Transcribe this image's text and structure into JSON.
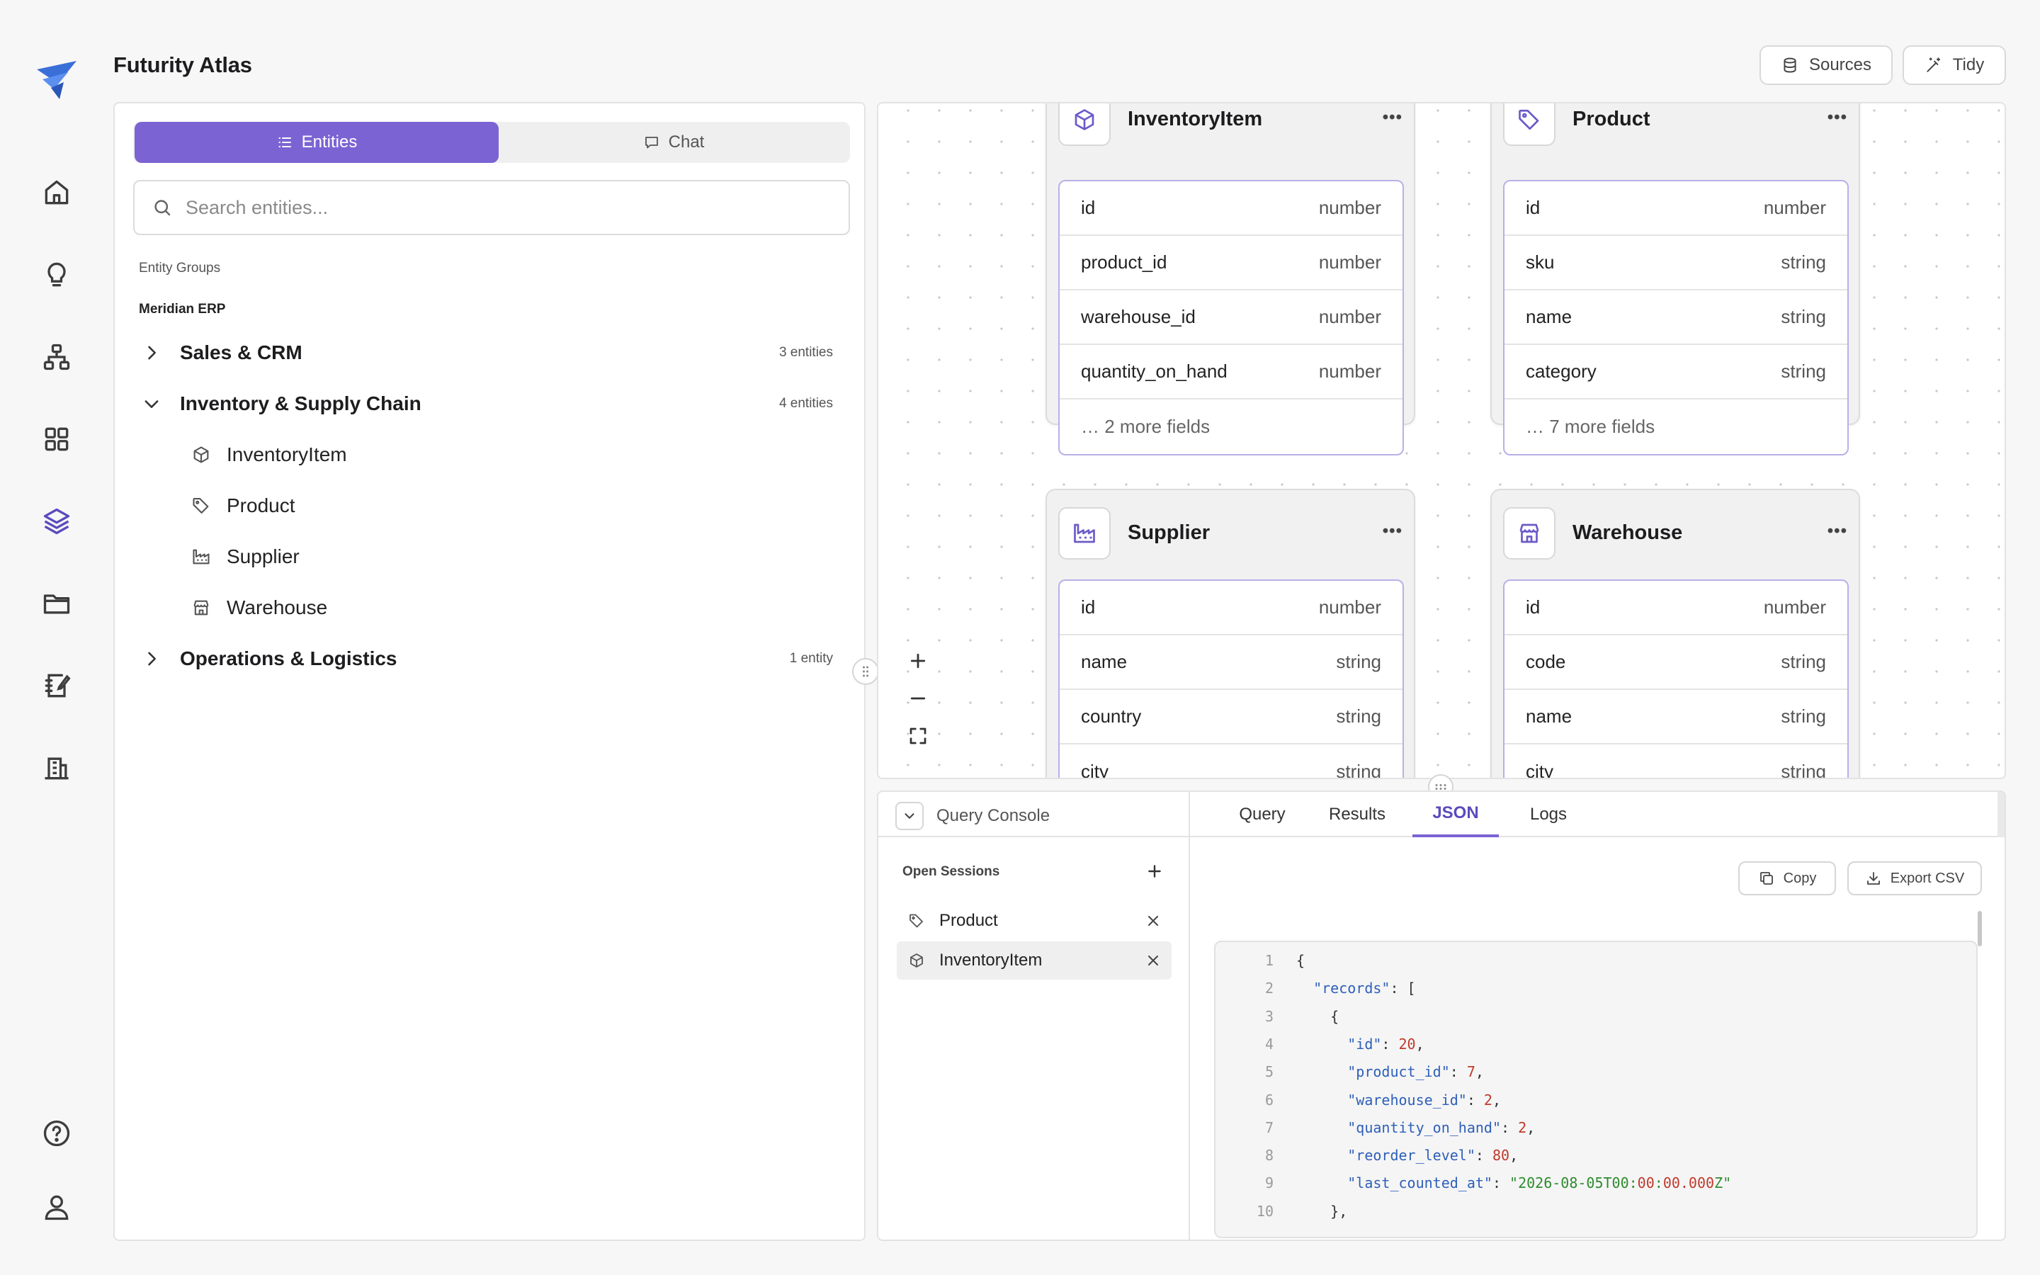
{
  "app": {
    "title": "Futurity Atlas"
  },
  "header": {
    "sources_label": "Sources",
    "tidy_label": "Tidy"
  },
  "nav": {
    "items": [
      {
        "icon": "home-icon"
      },
      {
        "icon": "lightbulb-icon"
      },
      {
        "icon": "hierarchy-icon"
      },
      {
        "icon": "grid-icon"
      },
      {
        "icon": "layers-icon",
        "active": true
      },
      {
        "icon": "folder-icon"
      },
      {
        "icon": "notebook-edit-icon"
      },
      {
        "icon": "building-icon"
      }
    ],
    "bottom": [
      {
        "icon": "help-icon"
      },
      {
        "icon": "user-icon"
      }
    ]
  },
  "left_panel": {
    "tabs": [
      {
        "label": "Entities",
        "active": true
      },
      {
        "label": "Chat"
      }
    ],
    "search_placeholder": "Search entities...",
    "section_label": "Entity Groups",
    "group_label": "Meridian ERP",
    "groups": [
      {
        "name": "Sales & CRM",
        "count": "3 entities",
        "expanded": false
      },
      {
        "name": "Inventory & Supply Chain",
        "count": "4 entities",
        "expanded": true,
        "items": [
          "InventoryItem",
          "Product",
          "Supplier",
          "Warehouse"
        ]
      },
      {
        "name": "Operations & Logistics",
        "count": "1 entity",
        "expanded": false
      }
    ]
  },
  "canvas": {
    "cards": [
      {
        "title": "InventoryItem",
        "icon": "box-icon",
        "fields": [
          [
            "id",
            "number"
          ],
          [
            "product_id",
            "number"
          ],
          [
            "warehouse_id",
            "number"
          ],
          [
            "quantity_on_hand",
            "number"
          ]
        ],
        "more": "… 2 more fields"
      },
      {
        "title": "Product",
        "icon": "tag-icon",
        "fields": [
          [
            "id",
            "number"
          ],
          [
            "sku",
            "string"
          ],
          [
            "name",
            "string"
          ],
          [
            "category",
            "string"
          ]
        ],
        "more": "… 7 more fields"
      },
      {
        "title": "Supplier",
        "icon": "factory-icon",
        "fields": [
          [
            "id",
            "number"
          ],
          [
            "name",
            "string"
          ],
          [
            "country",
            "string"
          ],
          [
            "city",
            "string"
          ]
        ]
      },
      {
        "title": "Warehouse",
        "icon": "store-icon",
        "fields": [
          [
            "id",
            "number"
          ],
          [
            "code",
            "string"
          ],
          [
            "name",
            "string"
          ],
          [
            "city",
            "string"
          ]
        ]
      }
    ],
    "more_glyph": "•••"
  },
  "console": {
    "title": "Query Console",
    "sessions_label": "Open Sessions",
    "sessions": [
      {
        "name": "Product",
        "icon": "tag-icon"
      },
      {
        "name": "InventoryItem",
        "icon": "box-icon",
        "active": true
      }
    ],
    "tabs": [
      {
        "label": "Query"
      },
      {
        "label": "Results"
      },
      {
        "label": "JSON",
        "active": true
      },
      {
        "label": "Logs"
      }
    ],
    "copy_label": "Copy",
    "export_label": "Export CSV",
    "json_lines": [
      "{",
      "  \"records\": [",
      "    {",
      "      \"id\": 20,",
      "      \"product_id\": 7,",
      "      \"warehouse_id\": 2,",
      "      \"quantity_on_hand\": 2,",
      "      \"reorder_level\": 80,",
      "      \"last_counted_at\": \"2026-08-05T00:00:00.000Z\"",
      "    },"
    ]
  },
  "colors": {
    "accent": "#7b63d4",
    "accent_text": "#5a4bbd",
    "json_key": "#2e5fb8",
    "json_number": "#c0392b",
    "json_string": "#2e8b2e"
  }
}
